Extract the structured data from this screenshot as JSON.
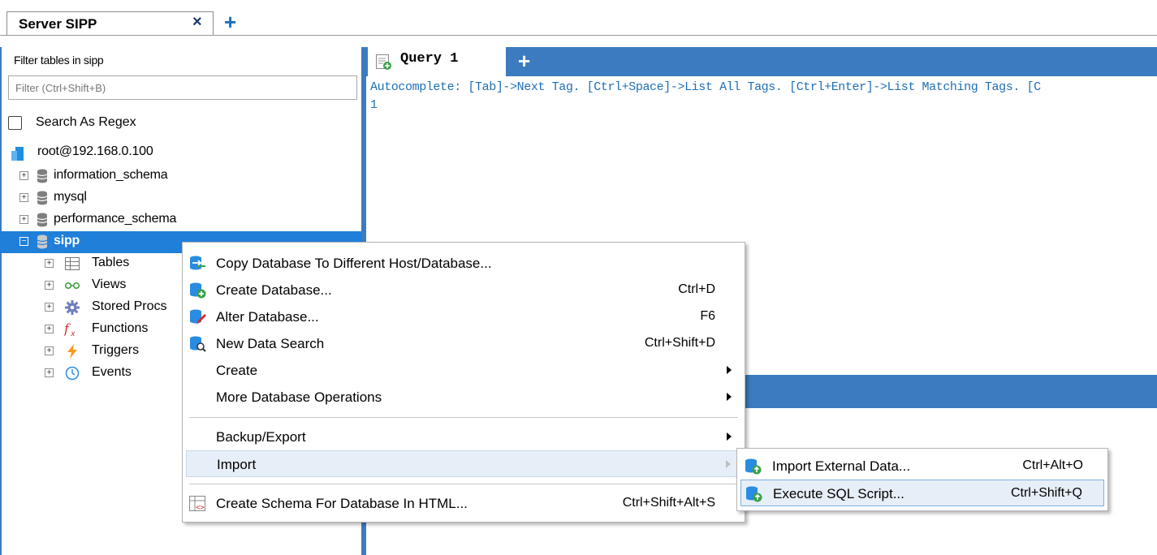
{
  "server_tab": {
    "label": "Server SIPP",
    "close": "×",
    "add": "+"
  },
  "left_panel": {
    "filter_label": "Filter tables in sipp",
    "filter_placeholder": "Filter (Ctrl+Shift+B)",
    "regex_label": "Search As Regex",
    "connection": "root@192.168.0.100",
    "databases": [
      {
        "name": "information_schema"
      },
      {
        "name": "mysql"
      },
      {
        "name": "performance_schema"
      },
      {
        "name": "sipp"
      }
    ],
    "selected_database": "sipp",
    "children": [
      {
        "label": "Tables",
        "icon": "table-icon"
      },
      {
        "label": "Views",
        "icon": "views-icon"
      },
      {
        "label": "Stored Procs",
        "icon": "gear-icon"
      },
      {
        "label": "Functions",
        "icon": "function-icon"
      },
      {
        "label": "Triggers",
        "icon": "lightning-icon"
      },
      {
        "label": "Events",
        "icon": "clock-icon"
      }
    ]
  },
  "query": {
    "tab_label": "Query 1",
    "add": "+",
    "autocomplete": "Autocomplete: [Tab]->Next Tag. [Ctrl+Space]->List All Tags. [Ctrl+Enter]->List Matching Tags. [C",
    "line_number": "1"
  },
  "context_menu": {
    "items": [
      {
        "label": "Copy Database To Different Host/Database...",
        "shortcut": "",
        "submenu": false,
        "icon": "copy-database-icon"
      },
      {
        "label": "Create Database...",
        "shortcut": "Ctrl+D",
        "submenu": false,
        "icon": "create-database-icon"
      },
      {
        "label": "Alter Database...",
        "shortcut": "F6",
        "submenu": false,
        "icon": "alter-database-icon"
      },
      {
        "label": "New Data Search",
        "shortcut": "Ctrl+Shift+D",
        "submenu": false,
        "icon": "data-search-icon"
      },
      {
        "label": "Create",
        "shortcut": "",
        "submenu": true,
        "icon": ""
      },
      {
        "label": "More Database Operations",
        "shortcut": "",
        "submenu": true,
        "icon": ""
      },
      {
        "label": "Backup/Export",
        "shortcut": "",
        "submenu": true,
        "icon": ""
      },
      {
        "label": "Import",
        "shortcut": "",
        "submenu": true,
        "icon": ""
      },
      {
        "label": "Create Schema For Database In HTML...",
        "shortcut": "Ctrl+Shift+Alt+S",
        "submenu": false,
        "icon": "schema-html-icon"
      }
    ],
    "highlighted": "Import"
  },
  "import_submenu": {
    "items": [
      {
        "label": "Import External Data...",
        "shortcut": "Ctrl+Alt+O",
        "icon": "import-data-icon"
      },
      {
        "label": "Execute SQL Script...",
        "shortcut": "Ctrl+Shift+Q",
        "icon": "execute-script-icon"
      }
    ],
    "highlighted": "Execute SQL Script..."
  },
  "colors": {
    "accent_blue": "#3c7bc0",
    "selection_blue": "#1f7fd9",
    "menu_highlight": "#e6eef7",
    "link_blue": "#1f6fb5"
  }
}
